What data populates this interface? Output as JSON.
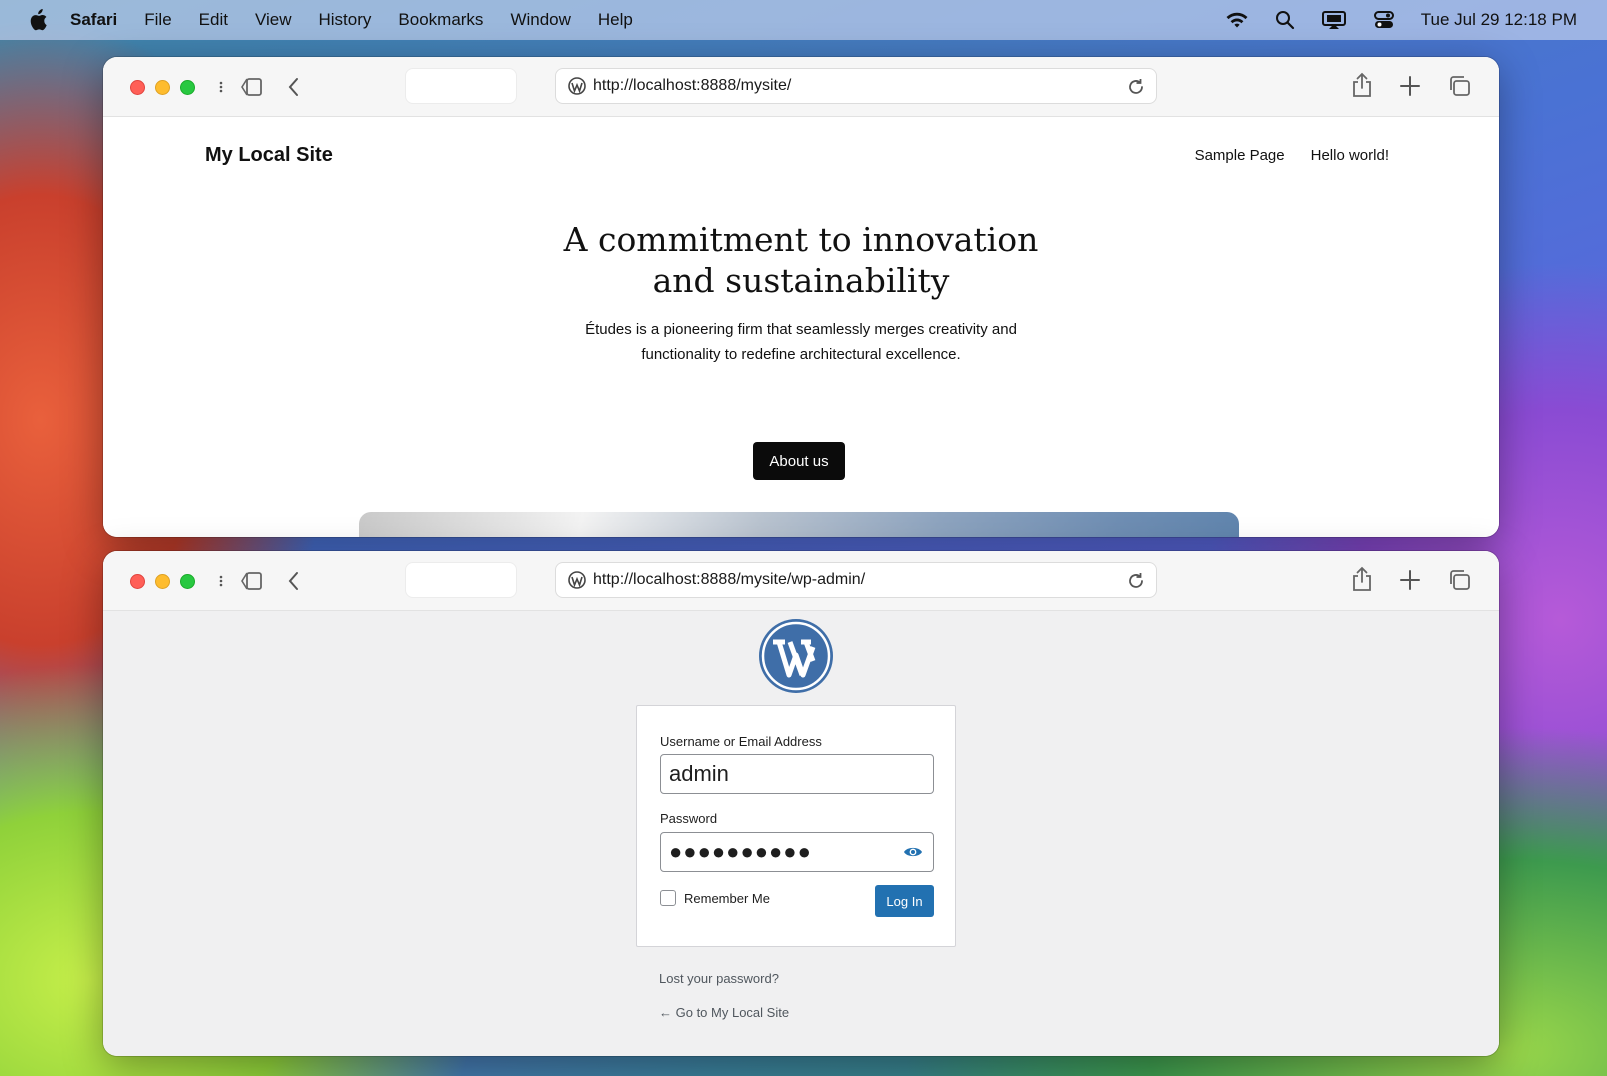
{
  "menubar": {
    "app": "Safari",
    "items": [
      "File",
      "Edit",
      "View",
      "History",
      "Bookmarks",
      "Window",
      "Help"
    ],
    "datetime": "Tue Jul 29  12:18 PM"
  },
  "windows": [
    {
      "url": "http://localhost:8888/mysite/"
    },
    {
      "url": "http://localhost:8888/mysite/wp-admin/"
    }
  ],
  "site": {
    "title": "My Local Site",
    "nav": [
      "Sample Page",
      "Hello world!"
    ],
    "heading_line1": "A commitment to innovation",
    "heading_line2": "and sustainability",
    "text_line1": "Études is a pioneering firm that seamlessly merges creativity and",
    "text_line2": "functionality to redefine architectural excellence.",
    "button": "About us"
  },
  "login": {
    "username_label": "Username or Email Address",
    "username_value": "admin",
    "password_label": "Password",
    "password_value": "●●●●●●●●●●",
    "remember_label": "Remember Me",
    "login_button": "Log In",
    "lost_password": "Lost your password?",
    "back_link": "← Go to My Local Site"
  },
  "colors": {
    "wp_blue": "#2271b1",
    "wp_logo": "#3f6ea8"
  }
}
